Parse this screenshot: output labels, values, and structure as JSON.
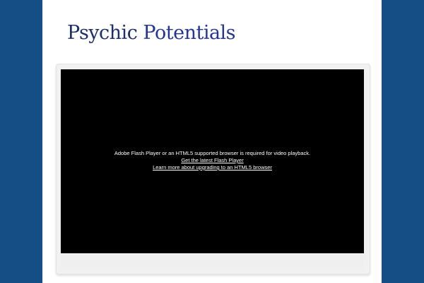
{
  "site": {
    "title_word_1": "Psychic",
    "title_word_2": "Potentials"
  },
  "video": {
    "message": "Adobe Flash Player or an HTML5 supported browser is required for video playback.",
    "flash_link": "Get the latest Flash Player",
    "html5_link": "Learn more about upgrading to an HTML5 browser"
  },
  "colors": {
    "background": "#154d85",
    "page": "#ffffff",
    "title": "#1c2e6b",
    "player": "#000000"
  }
}
